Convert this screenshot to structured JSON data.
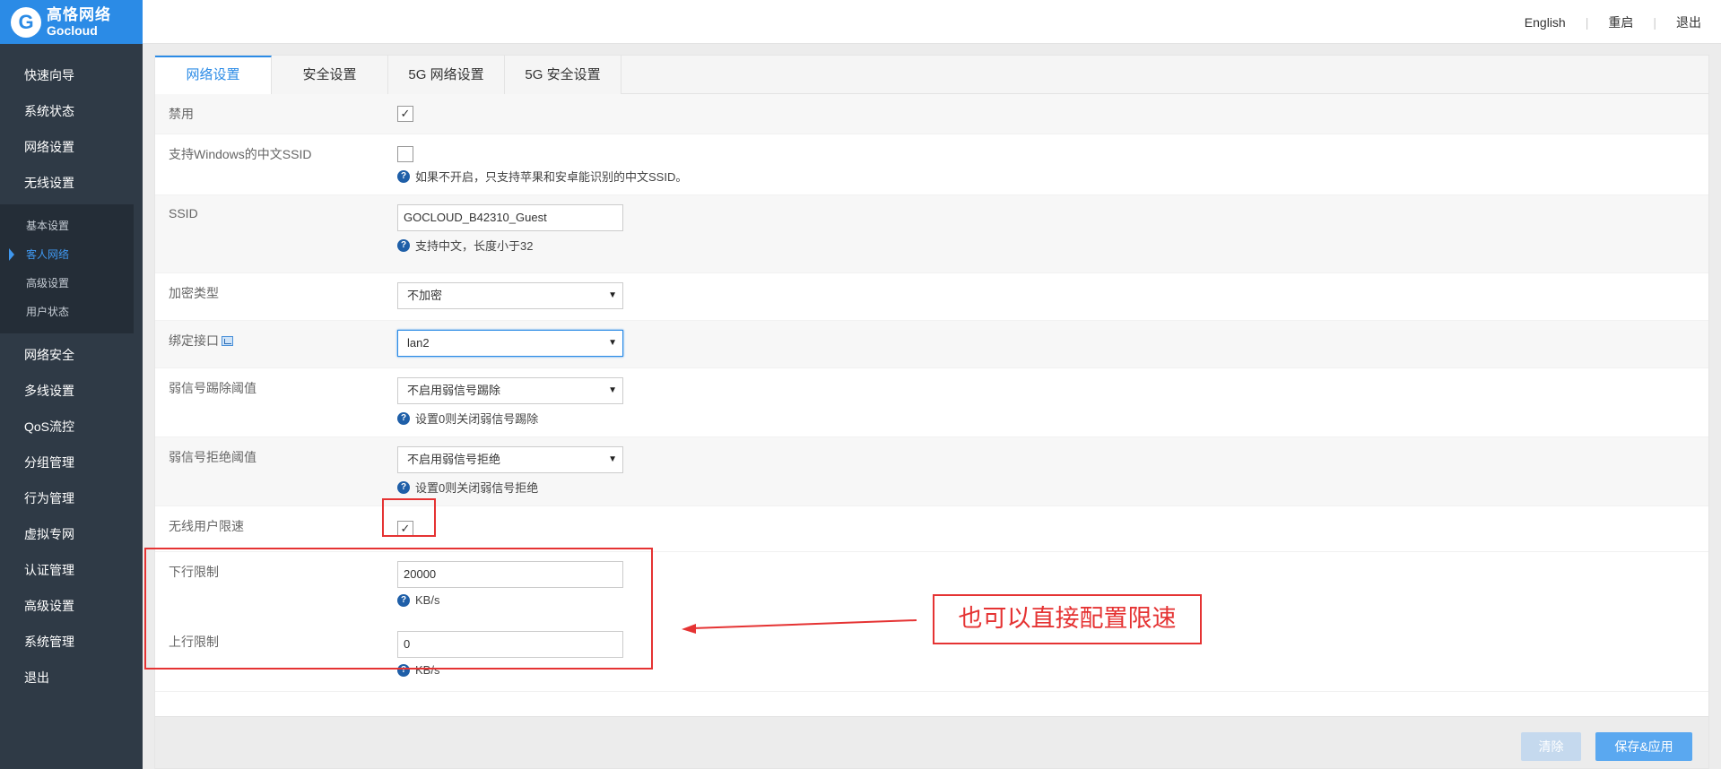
{
  "brand": {
    "name_cn": "高恪网络",
    "name_en": "Gocloud"
  },
  "top_links": [
    "English",
    "重启",
    "退出"
  ],
  "sidebar": {
    "items_top": [
      "快速向导",
      "系统状态",
      "网络设置",
      "无线设置"
    ],
    "subitems": [
      "基本设置",
      "客人网络",
      "高级设置",
      "用户状态"
    ],
    "active_subitem": "客人网络",
    "items_bottom": [
      "网络安全",
      "多线设置",
      "QoS流控",
      "分组管理",
      "行为管理",
      "虚拟专网",
      "认证管理",
      "高级设置",
      "系统管理",
      "退出"
    ]
  },
  "tabs": [
    "网络设置",
    "安全设置",
    "5G 网络设置",
    "5G 安全设置"
  ],
  "active_tab": "网络设置",
  "form": {
    "disable": {
      "label": "禁用",
      "checked": true
    },
    "windows_ssid": {
      "label": "支持Windows的中文SSID",
      "checked": false,
      "hint": "如果不开启，只支持苹果和安卓能识别的中文SSID。"
    },
    "ssid": {
      "label": "SSID",
      "value": "GOCLOUD_B42310_Guest",
      "hint": "支持中文，长度小于32"
    },
    "encryption": {
      "label": "加密类型",
      "value": "不加密"
    },
    "bind_interface": {
      "label": "绑定接口",
      "value": "lan2"
    },
    "weak_kick": {
      "label": "弱信号踢除阈值",
      "value": "不启用弱信号踢除",
      "hint": "设置0则关闭弱信号踢除"
    },
    "weak_reject": {
      "label": "弱信号拒绝阈值",
      "value": "不启用弱信号拒绝",
      "hint": "设置0则关闭弱信号拒绝"
    },
    "rate_limit": {
      "label": "无线用户限速",
      "checked": true
    },
    "down_limit": {
      "label": "下行限制",
      "value": "20000",
      "unit": "KB/s"
    },
    "up_limit": {
      "label": "上行限制",
      "value": "0",
      "unit": "KB/s"
    }
  },
  "annotation": "也可以直接配置限速",
  "buttons": {
    "clear": "清除",
    "save": "保存&应用"
  },
  "colors": {
    "accent": "#2b8be6",
    "sidebar": "#2f3a46",
    "annotation": "#e53333"
  }
}
